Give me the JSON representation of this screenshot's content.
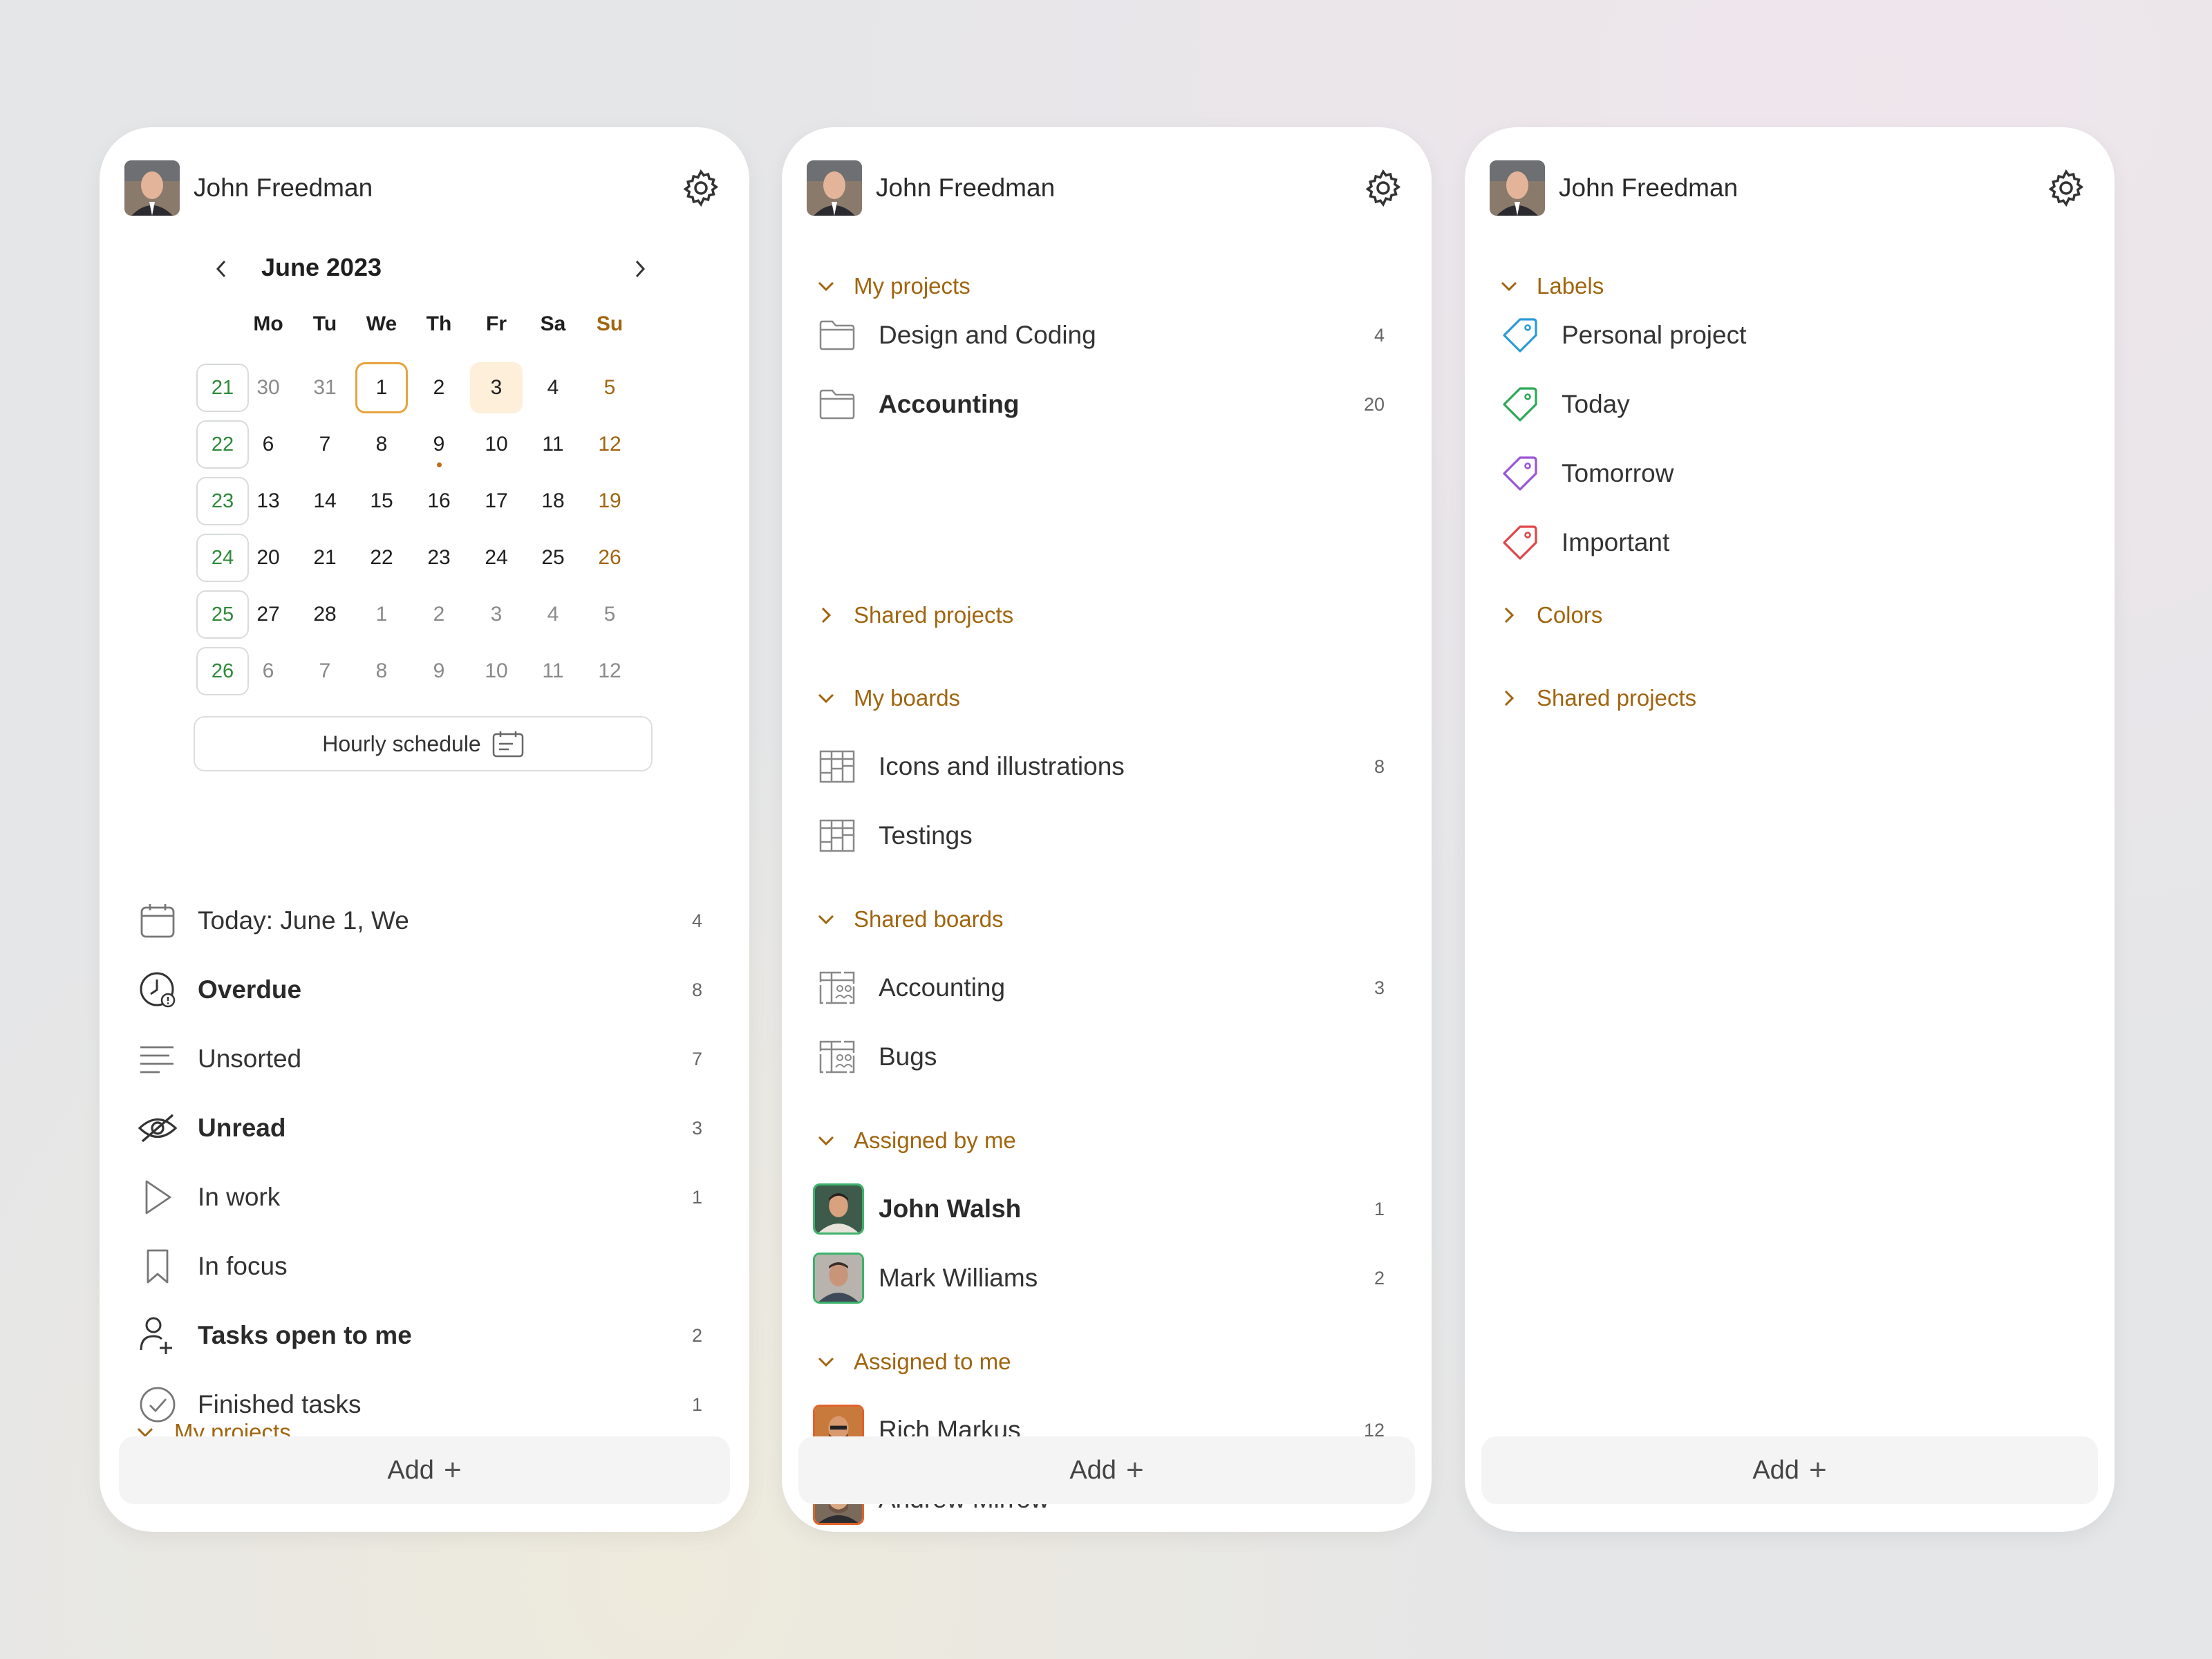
{
  "user": {
    "name": "John Freedman"
  },
  "calendar": {
    "title": "June 2023",
    "weekdays": [
      "Mo",
      "Tu",
      "We",
      "Th",
      "Fr",
      "Sa",
      "Su"
    ],
    "weeks": [
      "21",
      "22",
      "23",
      "24",
      "25",
      "26"
    ],
    "days": [
      [
        "30",
        "31",
        "1",
        "2",
        "3",
        "4",
        "5"
      ],
      [
        "6",
        "7",
        "8",
        "9",
        "10",
        "11",
        "12"
      ],
      [
        "13",
        "14",
        "15",
        "16",
        "17",
        "18",
        "19"
      ],
      [
        "20",
        "21",
        "22",
        "23",
        "24",
        "25",
        "26"
      ],
      [
        "27",
        "28",
        "1",
        "2",
        "3",
        "4",
        "5"
      ],
      [
        "6",
        "7",
        "8",
        "9",
        "10",
        "11",
        "12"
      ]
    ],
    "hourly_label": "Hourly schedule"
  },
  "panel1": {
    "filters": [
      {
        "label": "Today: June 1, We",
        "count": "4"
      },
      {
        "label": "Overdue",
        "count": "8"
      },
      {
        "label": "Unsorted",
        "count": "7"
      },
      {
        "label": "Unread",
        "count": "3"
      },
      {
        "label": "In work",
        "count": "1"
      },
      {
        "label": "In focus",
        "count": ""
      },
      {
        "label": "Tasks open to me",
        "count": "2"
      },
      {
        "label": "Finished tasks",
        "count": "1"
      }
    ],
    "section_my_projects": "My projects",
    "add_label": "Add"
  },
  "panel2": {
    "my_projects": "My projects",
    "projects": [
      {
        "label": "Design and Coding",
        "count": "4"
      },
      {
        "label": "Accounting",
        "count": "20"
      }
    ],
    "shared_projects": "Shared projects",
    "my_boards": "My boards",
    "boards": [
      {
        "label": "Icons and illustrations",
        "count": "8"
      },
      {
        "label": "Testings",
        "count": ""
      }
    ],
    "shared_boards": "Shared boards",
    "sboards": [
      {
        "label": "Accounting",
        "count": "3"
      },
      {
        "label": "Bugs",
        "count": ""
      }
    ],
    "assigned_by_me": "Assigned by me",
    "by_me": [
      {
        "label": "John Walsh",
        "count": "1"
      },
      {
        "label": "Mark Williams",
        "count": "2"
      }
    ],
    "assigned_to_me": "Assigned to me",
    "to_me": [
      {
        "label": "Rich Markus",
        "count": "12"
      },
      {
        "label": "Andrew Mirrow",
        "count": ""
      }
    ],
    "add_label": "Add"
  },
  "panel3": {
    "labels_title": "Labels",
    "labels": [
      {
        "label": "Personal project",
        "color": "#2a9bd8"
      },
      {
        "label": "Today",
        "color": "#2fa85a"
      },
      {
        "label": "Tomorrow",
        "color": "#9a55d6"
      },
      {
        "label": "Important",
        "color": "#e0464a"
      }
    ],
    "colors": "Colors",
    "shared_projects": "Shared projects",
    "add_label": "Add"
  },
  "colors": {
    "accent": "#a0650f",
    "week_green": "#2e8a3a",
    "today_ring": "#e8a33c"
  }
}
